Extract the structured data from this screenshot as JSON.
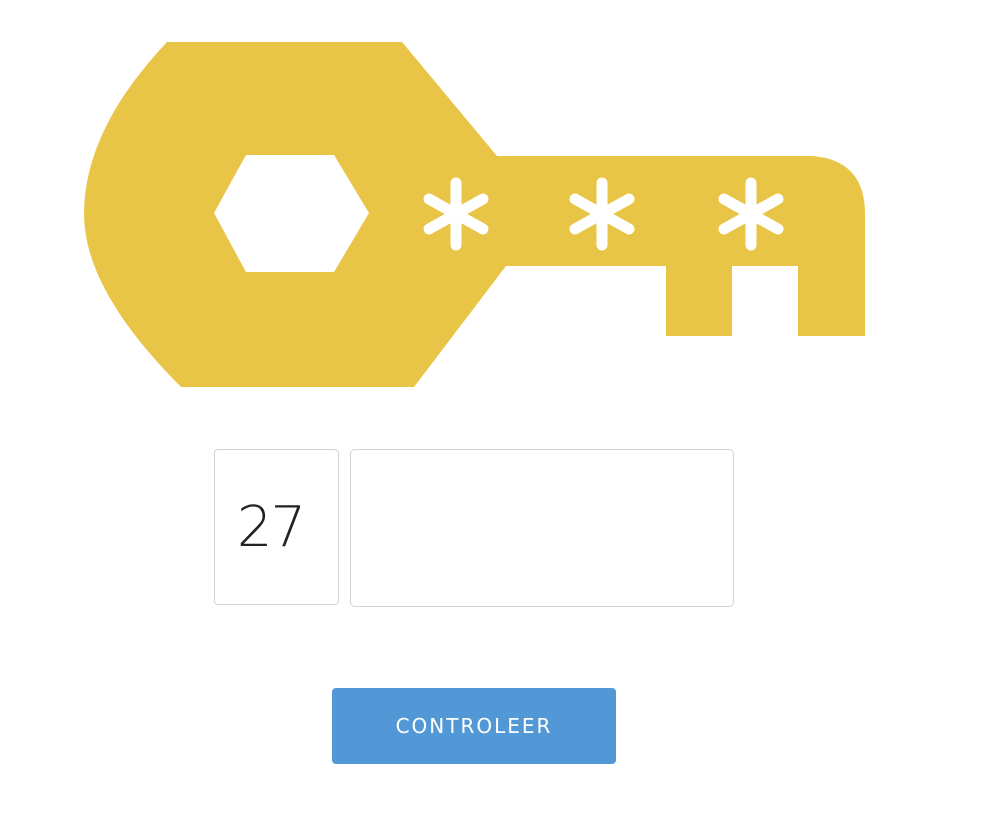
{
  "colors": {
    "key": "#e9c547",
    "button": "#5298d6",
    "border": "#d4d4d4",
    "text": "#222222"
  },
  "illustration": {
    "icon": "key-icon",
    "masked_chars": [
      "*",
      "*",
      "*"
    ]
  },
  "code_form": {
    "prefix": "27",
    "input_value": "",
    "input_placeholder": ""
  },
  "check_button": {
    "label": "CONTROLEER"
  }
}
